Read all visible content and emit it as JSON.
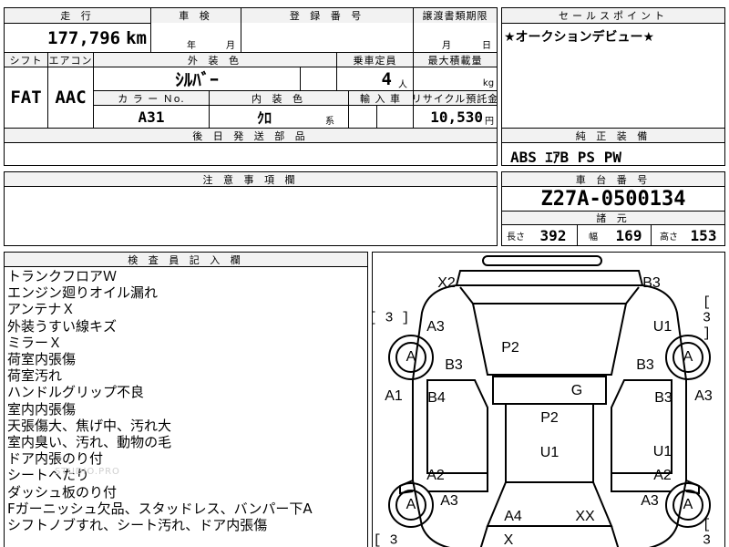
{
  "top": {
    "mileage_header": "走 行",
    "mileage": "177,796",
    "mileage_unit": "km",
    "inspection_header": "車 検",
    "year_label": "年",
    "month_label": "月",
    "registration_header": "登 録 番 号",
    "transfer_header": "譲渡書類期限",
    "transfer_month": "月",
    "transfer_day": "日",
    "sales_point_header": "セールスポイント",
    "sales_point": "★オークションデビュー★"
  },
  "specs": {
    "shift_header": "シフト",
    "shift": "FAT",
    "aircon_header": "エアコン",
    "aircon": "AAC",
    "ext_color_header": "外 装 色",
    "ext_color": "ｼﾙﾊﾞｰ",
    "capacity_header": "乗車定員",
    "capacity": "4",
    "capacity_unit": "人",
    "max_load_header": "最大積載量",
    "max_load_unit": "kg",
    "color_no_header": "カ ラ ー Ｎo.",
    "color_no": "A31",
    "int_color_header": "内 装 色",
    "int_color": "ｸﾛ",
    "int_color_suffix": "系",
    "import_header": "輸 入 車",
    "recycle_header": "リサイクル預託金",
    "recycle": "10,530",
    "recycle_unit": "円",
    "later_parts_header": "後 日 発 送 部 品"
  },
  "equipment": {
    "header": "純 正 装 備",
    "items": "ABS ｴｱB PS PW"
  },
  "notes": {
    "header": "注 意 事 項 欄"
  },
  "chassis": {
    "header": "車 台 番 号",
    "number": "Z27A-0500134",
    "dims_header": "諸 元",
    "length_label": "長さ",
    "length": "392",
    "width_label": "幅",
    "width": "169",
    "height_label": "高さ",
    "height": "153"
  },
  "inspector": {
    "header": "検 査 員 記 入 欄",
    "lines": [
      "トランクフロアＷ",
      "エンジン廻りオイル漏れ",
      "アンテナＸ",
      "外装うすい線キズ",
      "ミラーＸ",
      "荷室内張傷",
      "荷室汚れ",
      "ハンドルグリップ不良",
      "室内内張傷",
      "天張傷大、焦げ中、汚れ大",
      "室内臭い、汚れ、動物の毛",
      "ドア内張のり付",
      "シートへたり",
      "ダッシュ板のり付",
      "Fガーニッシュ欠品、スタッドレス、バンパー下A",
      "シフトノブすれ、シート汚れ、ドア内張傷"
    ],
    "watermark": "STUDIO.PRO"
  },
  "diagram": {
    "tire_left_top_tread": "[ 3 ]",
    "tire_right_top_tread": "[ 3 ]",
    "tire_left_bottom_tread": "[ 3",
    "tire_right_bottom_tread": "[ 3 ]",
    "left_front_wheel": "A",
    "right_front_wheel": "A",
    "left_rear_wheel": "A",
    "right_rear_wheel": "A",
    "rear_bumper_left": "X2",
    "rear_bumper_right": "B3",
    "rear_left_quarter": "A3",
    "rear_right_quarter": "U1",
    "rear_left_lower": "B3",
    "rear_right_lower": "B3",
    "rear_glass": "P2",
    "left_side": "A1",
    "right_side": "A3",
    "left_rear_door": "B4",
    "right_rear_door": "B3",
    "roof_glass": "G",
    "roof": "P2",
    "roof_front": "U1",
    "left_front_door": "A2",
    "right_front_door": "U1",
    "right_front_door_lower": "A2",
    "left_front_fender": "A3",
    "right_front_fender": "A3",
    "hood_left": "A4",
    "hood_right": "XX",
    "front_bumper": "X"
  }
}
